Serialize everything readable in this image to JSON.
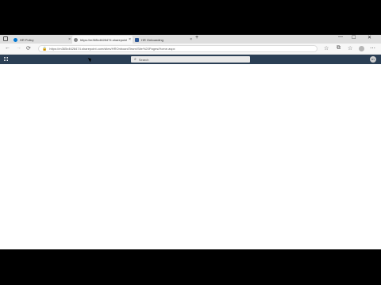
{
  "browser": {
    "tabs": [
      {
        "title": "HR Policy",
        "active": false,
        "favicon_color": "#0078d4"
      },
      {
        "title": "https://m365x46284​74.sharepoint...",
        "active": true,
        "favicon_color": "#888888"
      },
      {
        "title": "HR Onboarding",
        "active": false,
        "favicon_color": "#2b5797"
      }
    ],
    "new_tab_label": "+",
    "close_glyph": "×",
    "back_glyph": "←",
    "forward_glyph": "→",
    "refresh_glyph": "⟳",
    "address_url": "https://m365x46284​74.sharepoint.com/sites/HROnboardTeam/Site%20Pages/Home.aspx",
    "lock_glyph": "🔒",
    "minimize_glyph": "—",
    "maximize_glyph": "☐",
    "window_close_glyph": "✕",
    "star_glyph": "☆",
    "collections_glyph": "⧉",
    "menu_glyph": "⋯"
  },
  "suitebar": {
    "search_placeholder": "Search",
    "search_glyph": "⌕",
    "avatar_initials": "MV"
  },
  "colors": {
    "suitebar_bg": "#2b3f55",
    "tabstrip_bg": "#dedede"
  }
}
